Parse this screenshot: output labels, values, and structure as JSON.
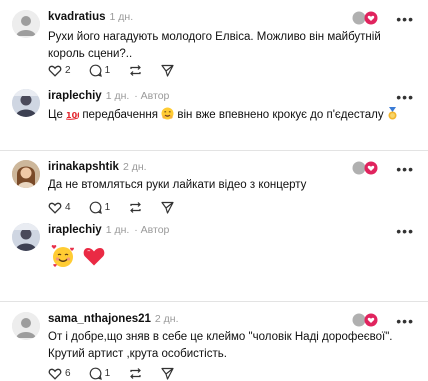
{
  "comments": [
    {
      "username": "kvadratius",
      "time": "1 дн.",
      "author_label": "",
      "lines": [
        "Рухи його нагадують молодого Елвіса. Можливо він майбутній",
        "король сцени?.."
      ],
      "likes": "2",
      "replies": "1"
    },
    {
      "username": "iraplechiy",
      "time": "1 дн.",
      "author_label": "Автор",
      "text_parts": [
        "Це",
        "передбачення",
        "він вже впевнено крокує до п'єдесталу"
      ]
    },
    {
      "username": "irinakapshtik",
      "time": "2 дн.",
      "author_label": "",
      "lines": [
        "Да не втомляться руки лайкати відео з концерту"
      ],
      "likes": "4",
      "replies": "1"
    },
    {
      "username": "iraplechiy",
      "time": "1 дн.",
      "author_label": "Автор"
    },
    {
      "username": "sama_nthajones21",
      "time": "2 дн.",
      "author_label": "",
      "lines": [
        "От і добре,що зняв в себе це клеймо \"чоловік Наді дорофеєвої\".",
        "Крутий артист ,крута особистість."
      ],
      "likes": "6",
      "replies": "1"
    }
  ],
  "icons": {
    "more": "more-horizontal-icon",
    "like": "heart-outline-icon",
    "reply": "comment-bubble-icon",
    "repost": "repost-icon",
    "share": "send-icon"
  },
  "colors": {
    "accent_badge": "#e0245e",
    "divider": "#e3e3e3",
    "meta": "#9a9a9a"
  }
}
